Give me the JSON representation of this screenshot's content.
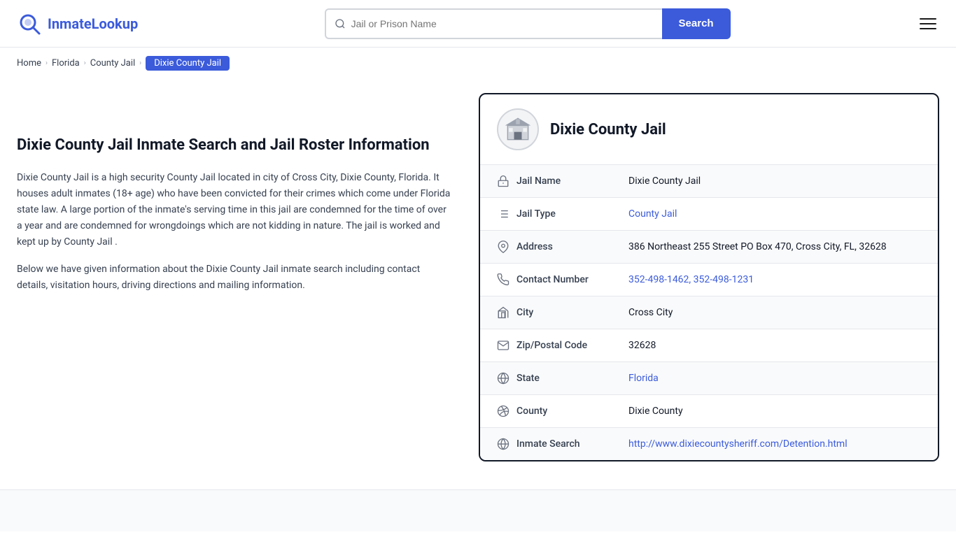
{
  "header": {
    "logo_text_plain": "Inmate",
    "logo_text_accent": "Lookup",
    "search_placeholder": "Jail or Prison Name",
    "search_button_label": "Search",
    "hamburger_label": "Menu"
  },
  "breadcrumb": {
    "home": "Home",
    "florida": "Florida",
    "county_jail": "County Jail",
    "current": "Dixie County Jail"
  },
  "left": {
    "title": "Dixie County Jail Inmate Search and Jail Roster Information",
    "description1": "Dixie County Jail is a high security County Jail located in city of Cross City, Dixie County, Florida. It houses adult inmates (18+ age) who have been convicted for their crimes which come under Florida state law. A large portion of the inmate's serving time in this jail are condemned for the time of over a year and are condemned for wrongdoings which are not kidding in nature. The jail is worked and kept up by County Jail .",
    "description2": "Below we have given information about the Dixie County Jail inmate search including contact details, visitation hours, driving directions and mailing information."
  },
  "card": {
    "title": "Dixie County Jail",
    "rows": [
      {
        "label": "Jail Name",
        "value": "Dixie County Jail",
        "link": null,
        "icon": "jail-icon"
      },
      {
        "label": "Jail Type",
        "value": "County Jail",
        "link": "#",
        "icon": "list-icon"
      },
      {
        "label": "Address",
        "value": "386 Northeast 255 Street PO Box 470, Cross City, FL, 32628",
        "link": null,
        "icon": "location-icon"
      },
      {
        "label": "Contact Number",
        "value": "352-498-1462, 352-498-1231",
        "link": "#",
        "icon": "phone-icon"
      },
      {
        "label": "City",
        "value": "Cross City",
        "link": null,
        "icon": "city-icon"
      },
      {
        "label": "Zip/Postal Code",
        "value": "32628",
        "link": null,
        "icon": "mail-icon"
      },
      {
        "label": "State",
        "value": "Florida",
        "link": "#",
        "icon": "globe-icon"
      },
      {
        "label": "County",
        "value": "Dixie County",
        "link": null,
        "icon": "county-icon"
      },
      {
        "label": "Inmate Search",
        "value": "http://www.dixiecountysheriff.com/Detention.html",
        "link": "http://www.dixiecountysheriff.com/Detention.html",
        "icon": "web-icon"
      }
    ]
  }
}
